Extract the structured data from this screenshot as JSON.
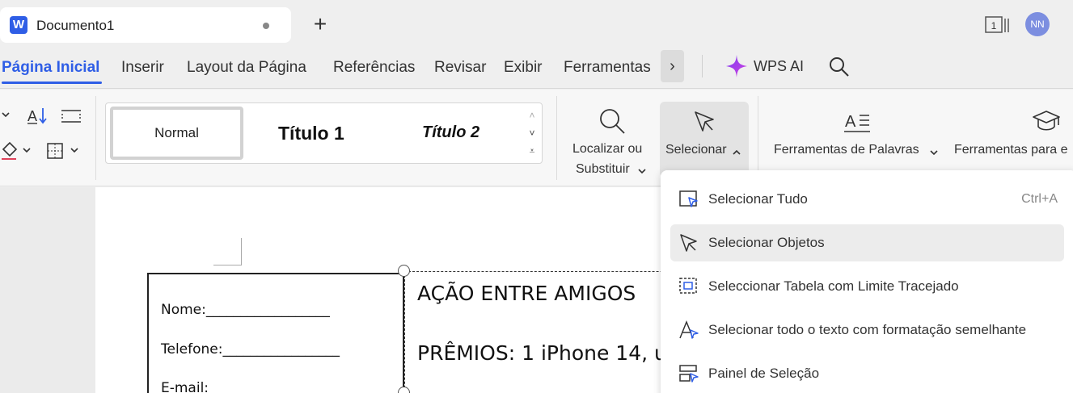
{
  "app": {
    "doc_tab_title": "Documento1",
    "logo_letter": "W",
    "page_count_indicator": "1",
    "user_initials": "NN"
  },
  "menu": {
    "tabs": [
      "Página Inicial",
      "Inserir",
      "Layout da Página",
      "Referências",
      "Revisar",
      "Exibir",
      "Ferramentas"
    ],
    "active_tab": "Página Inicial",
    "wps_ai": "WPS AI"
  },
  "ribbon": {
    "styles": {
      "normal": "Normal",
      "title1": "Título 1",
      "title2": "Título 2"
    },
    "find_replace_line1": "Localizar ou",
    "find_replace_line2": "Substituir",
    "select": "Selecionar",
    "word_tools": "Ferramentas de Palavras",
    "tools_for": "Ferramentas para e"
  },
  "document": {
    "form_lines": [
      "Nome:__________________",
      "Telefone:_________________",
      "E-mail:"
    ],
    "textbox_lines": [
      "AÇÃO ENTRE AMIGOS",
      "PRÊMIOS: 1 iPhone 14, u"
    ]
  },
  "dropdown": {
    "items": [
      {
        "label": "Selecionar Tudo",
        "shortcut": "Ctrl+A",
        "icon": "select-all-icon"
      },
      {
        "label": "Selecionar Objetos",
        "shortcut": "",
        "icon": "select-objects-icon"
      },
      {
        "label": "Seleccionar Tabela com Limite Tracejado",
        "shortcut": "",
        "icon": "select-table-icon"
      },
      {
        "label": "Selecionar todo o texto com formatação semelhante",
        "shortcut": "",
        "icon": "select-similar-text-icon"
      },
      {
        "label": "Painel de Seleção",
        "shortcut": "",
        "icon": "selection-pane-icon"
      }
    ]
  },
  "colors": {
    "accent": "#2f5ee6",
    "wps_ai_gradient": [
      "#7b3ff2",
      "#c53ff2"
    ]
  }
}
